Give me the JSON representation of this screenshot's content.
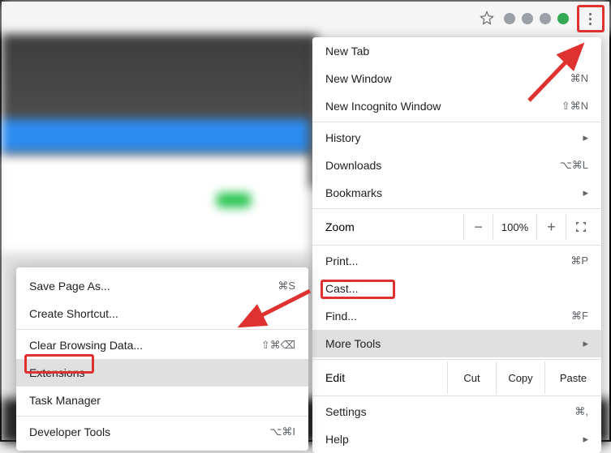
{
  "toolbar": {
    "star": "bookmark-star"
  },
  "mainMenu": {
    "newTab": "New Tab",
    "newWindow": "New Window",
    "newIncognito": "New Incognito Window",
    "newIncognitoShortcut": "⇧⌘N",
    "history": "History",
    "downloads": "Downloads",
    "downloadsShortcut": "⌥⌘L",
    "bookmarks": "Bookmarks",
    "zoom": "Zoom",
    "zoomMinus": "−",
    "zoomValue": "100%",
    "zoomPlus": "+",
    "print": "Print...",
    "printShortcut": "⌘P",
    "cast": "Cast...",
    "find": "Find...",
    "findShortcut": "⌘F",
    "moreTools": "More Tools",
    "edit": "Edit",
    "cut": "Cut",
    "copy": "Copy",
    "paste": "Paste",
    "settings": "Settings",
    "settingsShortcut": "⌘,",
    "help": "Help"
  },
  "subMenu": {
    "savePage": "Save Page As...",
    "savePageShortcut": "⌘S",
    "createShortcut": "Create Shortcut...",
    "clearBrowsing": "Clear Browsing Data...",
    "clearBrowsingShortcut": "⇧⌘⌫",
    "extensions": "Extensions",
    "taskManager": "Task Manager",
    "developerTools": "Developer Tools",
    "developerToolsShortcut": "⌥⌘I"
  }
}
